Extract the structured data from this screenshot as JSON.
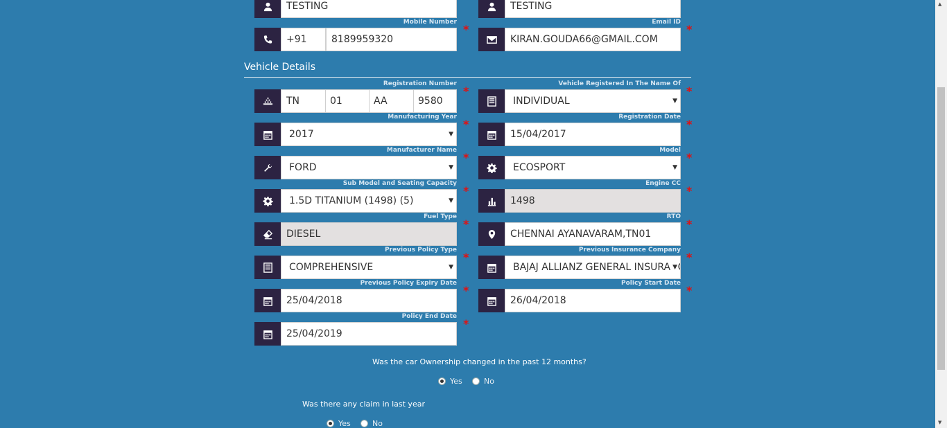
{
  "personal": {
    "first_name": "TESTING",
    "last_name": "TESTING",
    "mobile_label": "Mobile Number",
    "country_code": "+91",
    "mobile": "8189959320",
    "email_label": "Email ID",
    "email": "KIRAN.GOUDA66@GMAIL.COM"
  },
  "vehicle": {
    "section_title": "Vehicle Details",
    "registration_label": "Registration Number",
    "reg_state": "TN",
    "reg_district": "01",
    "reg_series": "AA",
    "reg_number": "9580",
    "registered_name_label": "Vehicle Registered In The Name Of",
    "registered_name": "INDIVIDUAL",
    "mfg_year_label": "Manufacturing Year",
    "mfg_year": "2017",
    "reg_date_label": "Registration Date",
    "reg_date": "15/04/2017",
    "manufacturer_label": "Manufacturer Name",
    "manufacturer": "FORD",
    "model_label": "Model",
    "model": "ECOSPORT",
    "sub_model_label": "Sub Model and Seating Capacity",
    "sub_model": "1.5D TITANIUM (1498) (5)",
    "engine_cc_label": "Engine CC",
    "engine_cc": "1498",
    "fuel_label": "Fuel Type",
    "fuel": "DIESEL",
    "rto_label": "RTO",
    "rto": "CHENNAI AYANAVARAM,TN01",
    "prev_policy_type_label": "Previous Policy Type",
    "prev_policy_type": "COMPREHENSIVE",
    "prev_insurer_label": "Previous Insurance Company",
    "prev_insurer": "BAJAJ ALLIANZ GENERAL INSURANCE",
    "prev_expiry_label": "Previous Policy Expiry Date",
    "prev_expiry": "25/04/2018",
    "policy_start_label": "Policy Start Date",
    "policy_start": "26/04/2018",
    "policy_end_label": "Policy End Date",
    "policy_end": "25/04/2019"
  },
  "questions": {
    "ownership": "Was the car Ownership changed in the past 12 months?",
    "claim": "Was there any claim in last year",
    "yes": "Yes",
    "no": "No"
  },
  "required_mark": "*",
  "caret": "▼",
  "colors": {
    "background": "#2d7cad",
    "icon_box": "#2c2342",
    "required": "#e31010",
    "readonly": "#e3e0e0"
  }
}
